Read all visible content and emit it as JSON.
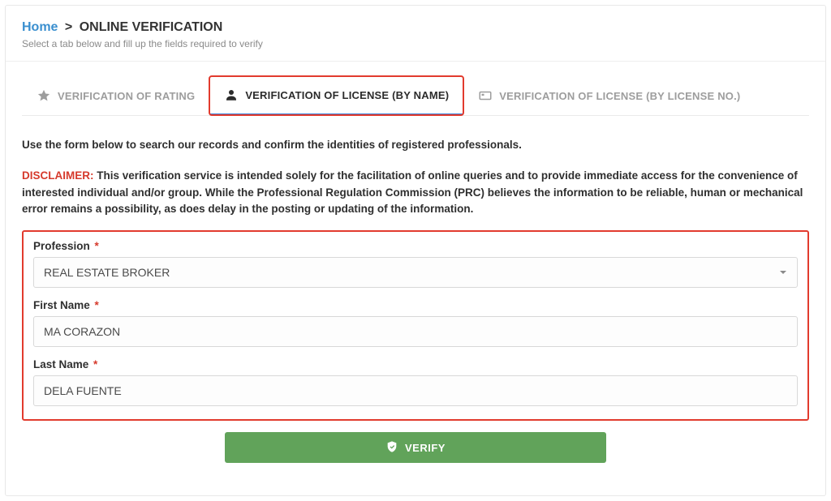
{
  "breadcrumb": {
    "home": "Home",
    "separator": ">",
    "title": "ONLINE VERIFICATION"
  },
  "subheading": "Select a tab below and fill up the fields required to verify",
  "tabs": {
    "rating": "VERIFICATION OF RATING",
    "by_name": "VERIFICATION OF LICENSE (BY NAME)",
    "by_no": "VERIFICATION OF LICENSE (BY LICENSE NO.)"
  },
  "instructions": "Use the form below to search our records and confirm the identities of registered professionals.",
  "disclaimer": {
    "label": "DISCLAIMER:",
    "text": "This verification service is intended solely for the facilitation of online queries and to provide immediate access for the convenience of interested individual and/or group. While the Professional Regulation Commission (PRC) believes the information to be reliable, human or mechanical error remains a possibility, as does delay in the posting or updating of the information."
  },
  "form": {
    "profession_label": "Profession",
    "profession_value": "REAL ESTATE BROKER",
    "first_name_label": "First Name",
    "first_name_value": "MA CORAZON",
    "last_name_label": "Last Name",
    "last_name_value": "DELA FUENTE",
    "required_mark": "*"
  },
  "verify_button": "VERIFY"
}
